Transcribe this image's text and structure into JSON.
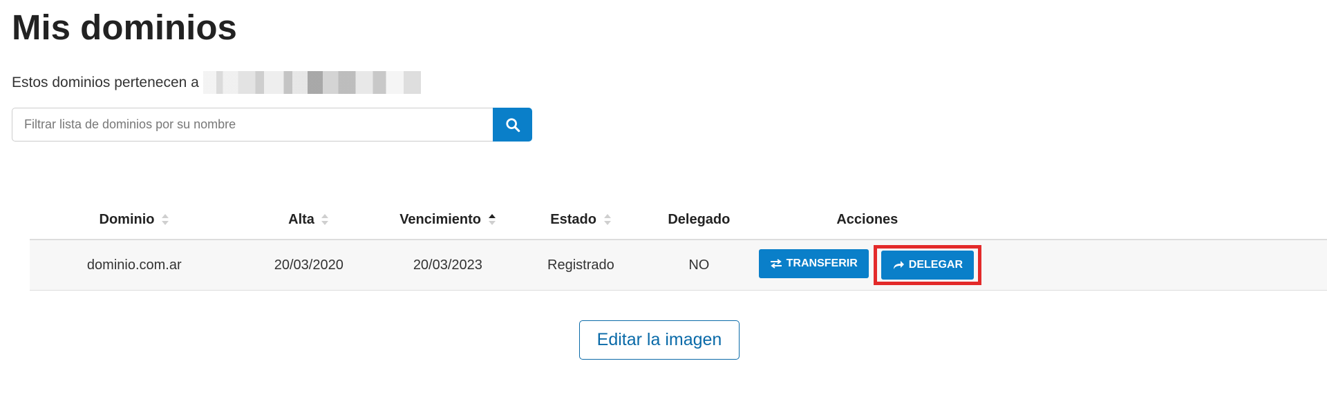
{
  "header": {
    "title": "Mis dominios",
    "owner_prefix": "Estos dominios pertenecen a"
  },
  "search": {
    "value": "",
    "placeholder": "Filtrar lista de dominios por su nombre",
    "button_icon": "search-icon"
  },
  "table": {
    "columns": [
      "Dominio",
      "Alta",
      "Vencimiento",
      "Estado",
      "Delegado",
      "Acciones"
    ],
    "sorted_column": "Vencimiento",
    "rows": [
      {
        "dominio": "dominio.com.ar",
        "alta": "20/03/2020",
        "vencimiento": "20/03/2023",
        "estado": "Registrado",
        "delegado": "NO",
        "actions": {
          "transfer_label": "TRANSFERIR",
          "transfer_icon": "swap-arrows-icon",
          "delegate_label": "DELEGAR",
          "delegate_icon": "share-arrow-icon"
        }
      }
    ]
  },
  "footer": {
    "edit_image_label": "Editar la imagen"
  },
  "colors": {
    "accent": "#0a7fc9",
    "highlight": "#e32a2a",
    "outline_button": "#0a6aa8"
  }
}
